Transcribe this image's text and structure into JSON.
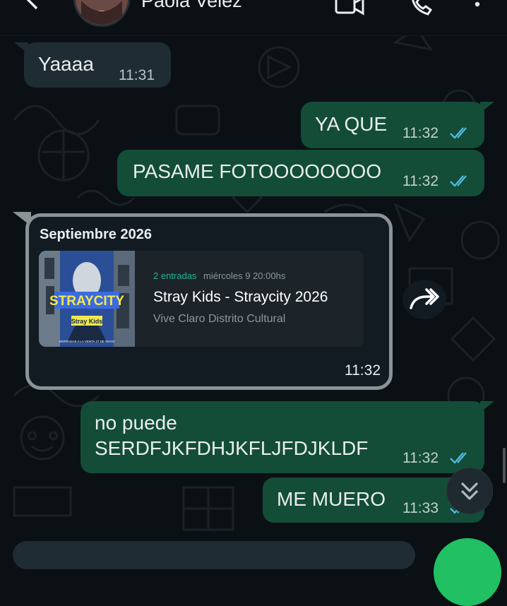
{
  "header": {
    "contact_name": "Paola Velez",
    "icons": [
      "back-arrow-icon",
      "video-call-icon",
      "voice-call-icon",
      "more-options-icon"
    ]
  },
  "messages": [
    {
      "direction": "incoming",
      "text": "Yaaaa",
      "time": "11:31"
    },
    {
      "direction": "outgoing",
      "text": "YA QUE",
      "time": "11:32",
      "status": "read"
    },
    {
      "direction": "outgoing",
      "text": "PASAME FOTOOOOOOOO",
      "time": "11:32",
      "status": "read"
    },
    {
      "direction": "outgoing",
      "text_lines": [
        "no puede",
        "SERDFJKFDHJKFLJFDJKLDF"
      ],
      "time": "11:32",
      "status": "read"
    },
    {
      "direction": "outgoing",
      "text": "ME MUERO",
      "time": "11:33",
      "status": "read"
    }
  ],
  "ticket_message": {
    "header": "Septiembre 2026",
    "ticket_count": "2 entradas",
    "date": "miércoles 9 20:00hs",
    "title": "Stray Kids - Straycity 2026",
    "venue": "Vive Claro Distrito Cultural",
    "time": "11:32",
    "poster": {
      "title": "STRAYCITY",
      "band": "Stray Kids",
      "fine_print": "ENTRADAS A LA VENTA 27 DE MAYO"
    }
  },
  "colors": {
    "background": "#0b1014",
    "incoming_bubble": "#1f2c33",
    "outgoing_bubble": "#134d37",
    "read_tick": "#53bdeb",
    "accent_green": "#21c063"
  }
}
